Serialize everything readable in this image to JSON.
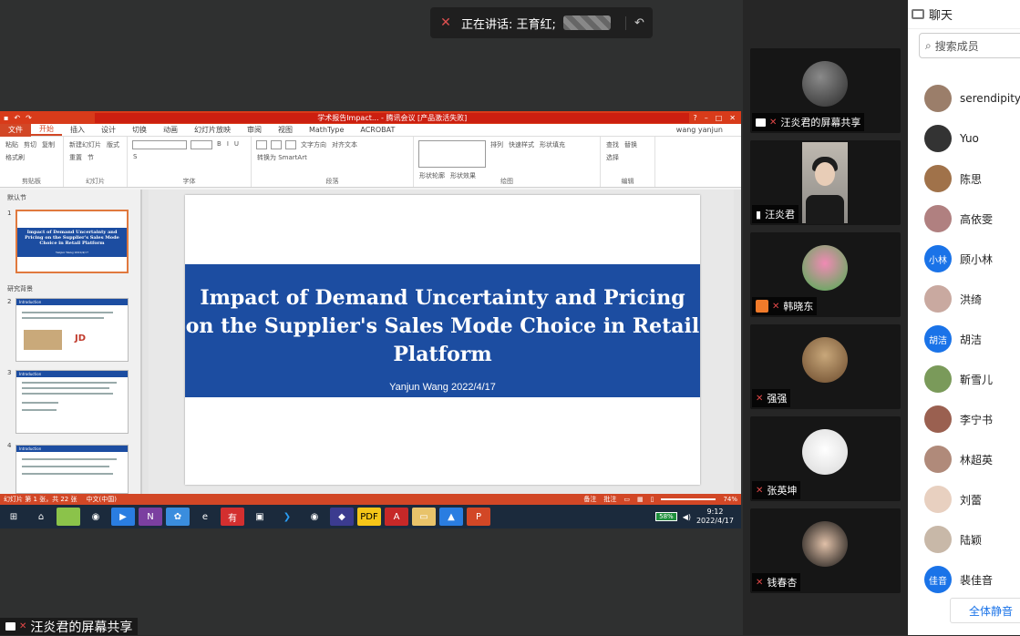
{
  "speaker": {
    "label": "正在讲话: 王育红;",
    "back_icon": "reply-icon"
  },
  "ppt": {
    "window_title": "学术报告Impact... - 腾讯会议 [产品激活失败]",
    "tabs": [
      "文件",
      "开始",
      "插入",
      "设计",
      "切换",
      "动画",
      "幻灯片放映",
      "审阅",
      "视图",
      "MathType",
      "ACROBAT"
    ],
    "active_tab": "开始",
    "user": "wang yanjun",
    "ribbon": {
      "clipboard": {
        "label": "剪贴板",
        "paste": "粘贴",
        "cut": "剪切",
        "copy": "复制",
        "format": "格式刷"
      },
      "slides": {
        "label": "幻灯片",
        "new": "新建幻灯片",
        "layout": "版式",
        "reset": "重置",
        "section": "节"
      },
      "font": {
        "label": "字体"
      },
      "paragraph": {
        "label": "段落",
        "dir": "文字方向",
        "align": "对齐文本",
        "smartart": "转换为 SmartArt"
      },
      "drawing": {
        "label": "绘图",
        "arrange": "排列",
        "styles": "快速样式",
        "fill": "形状填充",
        "outline": "形状轮廓",
        "effect": "形状效果"
      },
      "editing": {
        "label": "编辑",
        "find": "查找",
        "replace": "替换",
        "select": "选择"
      }
    },
    "sections": [
      "默认节",
      "研究背景"
    ],
    "thumb_titles": {
      "t1": "Impact of Demand Uncertainty and Pricing on the Supplier's Sales Mode Choice in Retail Platform",
      "t1sub": "Yanjun Wang 2022/4/17",
      "t2": "Introduction",
      "t2logo": "JD",
      "t3": "Introduction",
      "t4": "Introduction"
    },
    "slide_numbers": [
      "1",
      "2",
      "3",
      "4"
    ],
    "slide": {
      "title": "Impact of Demand Uncertainty and Pricing on the Supplier's Sales Mode Choice in Retail Platform",
      "subtitle": "Yanjun Wang 2022/4/17"
    },
    "status": {
      "slide": "幻灯片 第 1 张，共 22 张",
      "lang": "中文(中国)",
      "notes": "备注",
      "comments": "批注",
      "zoom": "74%"
    },
    "taskbar": {
      "battery": "58%",
      "time": "9:12",
      "date": "2022/4/17",
      "apps": [
        "file-icon",
        "chrome-icon",
        "meeting-icon",
        "onenote-icon",
        "app-icon",
        "ie-icon",
        "youdao-icon",
        "vm-icon",
        "vscode-icon",
        "chrome-icon",
        "app2-icon",
        "pdf-icon",
        "acrobat-icon",
        "explorer-icon",
        "tencent-icon",
        "powerpoint-icon"
      ]
    }
  },
  "share_caption": "汪炎君的屏幕共享",
  "videos": [
    {
      "name": "汪炎君的屏幕共享",
      "type": "share"
    },
    {
      "name": "汪炎君",
      "type": "camera"
    },
    {
      "name": "韩晓东",
      "type": "avatar"
    },
    {
      "name": "强强",
      "type": "avatar"
    },
    {
      "name": "张英坤",
      "type": "avatar"
    },
    {
      "name": "钱春杏",
      "type": "avatar"
    }
  ],
  "chat": {
    "title": "聊天",
    "search_placeholder": "搜索成员",
    "members": [
      "serendipity",
      "Yuo",
      "陈思",
      "高依雯",
      "顾小林",
      "洪绮",
      "胡洁",
      "靳雪儿",
      "李宁书",
      "林超英",
      "刘蕾",
      "陆颖",
      "裴佳音"
    ],
    "initials": {
      "顾小林": "小林",
      "胡洁": "胡洁",
      "裴佳音": "佳音"
    },
    "mute_all": "全体静音"
  },
  "colors": {
    "accent": "#1a73e8",
    "ppt_red": "#d24726",
    "slide_blue": "#1c4da1"
  }
}
